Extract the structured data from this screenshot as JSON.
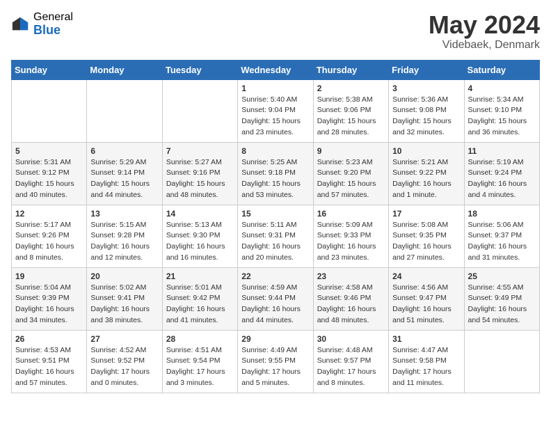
{
  "header": {
    "logo_general": "General",
    "logo_blue": "Blue",
    "title": "May 2024",
    "subtitle": "Videbaek, Denmark"
  },
  "weekdays": [
    "Sunday",
    "Monday",
    "Tuesday",
    "Wednesday",
    "Thursday",
    "Friday",
    "Saturday"
  ],
  "weeks": [
    [
      {
        "day": "",
        "sunrise": "",
        "sunset": "",
        "daylight": ""
      },
      {
        "day": "",
        "sunrise": "",
        "sunset": "",
        "daylight": ""
      },
      {
        "day": "",
        "sunrise": "",
        "sunset": "",
        "daylight": ""
      },
      {
        "day": "1",
        "sunrise": "Sunrise: 5:40 AM",
        "sunset": "Sunset: 9:04 PM",
        "daylight": "Daylight: 15 hours and 23 minutes."
      },
      {
        "day": "2",
        "sunrise": "Sunrise: 5:38 AM",
        "sunset": "Sunset: 9:06 PM",
        "daylight": "Daylight: 15 hours and 28 minutes."
      },
      {
        "day": "3",
        "sunrise": "Sunrise: 5:36 AM",
        "sunset": "Sunset: 9:08 PM",
        "daylight": "Daylight: 15 hours and 32 minutes."
      },
      {
        "day": "4",
        "sunrise": "Sunrise: 5:34 AM",
        "sunset": "Sunset: 9:10 PM",
        "daylight": "Daylight: 15 hours and 36 minutes."
      }
    ],
    [
      {
        "day": "5",
        "sunrise": "Sunrise: 5:31 AM",
        "sunset": "Sunset: 9:12 PM",
        "daylight": "Daylight: 15 hours and 40 minutes."
      },
      {
        "day": "6",
        "sunrise": "Sunrise: 5:29 AM",
        "sunset": "Sunset: 9:14 PM",
        "daylight": "Daylight: 15 hours and 44 minutes."
      },
      {
        "day": "7",
        "sunrise": "Sunrise: 5:27 AM",
        "sunset": "Sunset: 9:16 PM",
        "daylight": "Daylight: 15 hours and 48 minutes."
      },
      {
        "day": "8",
        "sunrise": "Sunrise: 5:25 AM",
        "sunset": "Sunset: 9:18 PM",
        "daylight": "Daylight: 15 hours and 53 minutes."
      },
      {
        "day": "9",
        "sunrise": "Sunrise: 5:23 AM",
        "sunset": "Sunset: 9:20 PM",
        "daylight": "Daylight: 15 hours and 57 minutes."
      },
      {
        "day": "10",
        "sunrise": "Sunrise: 5:21 AM",
        "sunset": "Sunset: 9:22 PM",
        "daylight": "Daylight: 16 hours and 1 minute."
      },
      {
        "day": "11",
        "sunrise": "Sunrise: 5:19 AM",
        "sunset": "Sunset: 9:24 PM",
        "daylight": "Daylight: 16 hours and 4 minutes."
      }
    ],
    [
      {
        "day": "12",
        "sunrise": "Sunrise: 5:17 AM",
        "sunset": "Sunset: 9:26 PM",
        "daylight": "Daylight: 16 hours and 8 minutes."
      },
      {
        "day": "13",
        "sunrise": "Sunrise: 5:15 AM",
        "sunset": "Sunset: 9:28 PM",
        "daylight": "Daylight: 16 hours and 12 minutes."
      },
      {
        "day": "14",
        "sunrise": "Sunrise: 5:13 AM",
        "sunset": "Sunset: 9:30 PM",
        "daylight": "Daylight: 16 hours and 16 minutes."
      },
      {
        "day": "15",
        "sunrise": "Sunrise: 5:11 AM",
        "sunset": "Sunset: 9:31 PM",
        "daylight": "Daylight: 16 hours and 20 minutes."
      },
      {
        "day": "16",
        "sunrise": "Sunrise: 5:09 AM",
        "sunset": "Sunset: 9:33 PM",
        "daylight": "Daylight: 16 hours and 23 minutes."
      },
      {
        "day": "17",
        "sunrise": "Sunrise: 5:08 AM",
        "sunset": "Sunset: 9:35 PM",
        "daylight": "Daylight: 16 hours and 27 minutes."
      },
      {
        "day": "18",
        "sunrise": "Sunrise: 5:06 AM",
        "sunset": "Sunset: 9:37 PM",
        "daylight": "Daylight: 16 hours and 31 minutes."
      }
    ],
    [
      {
        "day": "19",
        "sunrise": "Sunrise: 5:04 AM",
        "sunset": "Sunset: 9:39 PM",
        "daylight": "Daylight: 16 hours and 34 minutes."
      },
      {
        "day": "20",
        "sunrise": "Sunrise: 5:02 AM",
        "sunset": "Sunset: 9:41 PM",
        "daylight": "Daylight: 16 hours and 38 minutes."
      },
      {
        "day": "21",
        "sunrise": "Sunrise: 5:01 AM",
        "sunset": "Sunset: 9:42 PM",
        "daylight": "Daylight: 16 hours and 41 minutes."
      },
      {
        "day": "22",
        "sunrise": "Sunrise: 4:59 AM",
        "sunset": "Sunset: 9:44 PM",
        "daylight": "Daylight: 16 hours and 44 minutes."
      },
      {
        "day": "23",
        "sunrise": "Sunrise: 4:58 AM",
        "sunset": "Sunset: 9:46 PM",
        "daylight": "Daylight: 16 hours and 48 minutes."
      },
      {
        "day": "24",
        "sunrise": "Sunrise: 4:56 AM",
        "sunset": "Sunset: 9:47 PM",
        "daylight": "Daylight: 16 hours and 51 minutes."
      },
      {
        "day": "25",
        "sunrise": "Sunrise: 4:55 AM",
        "sunset": "Sunset: 9:49 PM",
        "daylight": "Daylight: 16 hours and 54 minutes."
      }
    ],
    [
      {
        "day": "26",
        "sunrise": "Sunrise: 4:53 AM",
        "sunset": "Sunset: 9:51 PM",
        "daylight": "Daylight: 16 hours and 57 minutes."
      },
      {
        "day": "27",
        "sunrise": "Sunrise: 4:52 AM",
        "sunset": "Sunset: 9:52 PM",
        "daylight": "Daylight: 17 hours and 0 minutes."
      },
      {
        "day": "28",
        "sunrise": "Sunrise: 4:51 AM",
        "sunset": "Sunset: 9:54 PM",
        "daylight": "Daylight: 17 hours and 3 minutes."
      },
      {
        "day": "29",
        "sunrise": "Sunrise: 4:49 AM",
        "sunset": "Sunset: 9:55 PM",
        "daylight": "Daylight: 17 hours and 5 minutes."
      },
      {
        "day": "30",
        "sunrise": "Sunrise: 4:48 AM",
        "sunset": "Sunset: 9:57 PM",
        "daylight": "Daylight: 17 hours and 8 minutes."
      },
      {
        "day": "31",
        "sunrise": "Sunrise: 4:47 AM",
        "sunset": "Sunset: 9:58 PM",
        "daylight": "Daylight: 17 hours and 11 minutes."
      },
      {
        "day": "",
        "sunrise": "",
        "sunset": "",
        "daylight": ""
      }
    ]
  ]
}
